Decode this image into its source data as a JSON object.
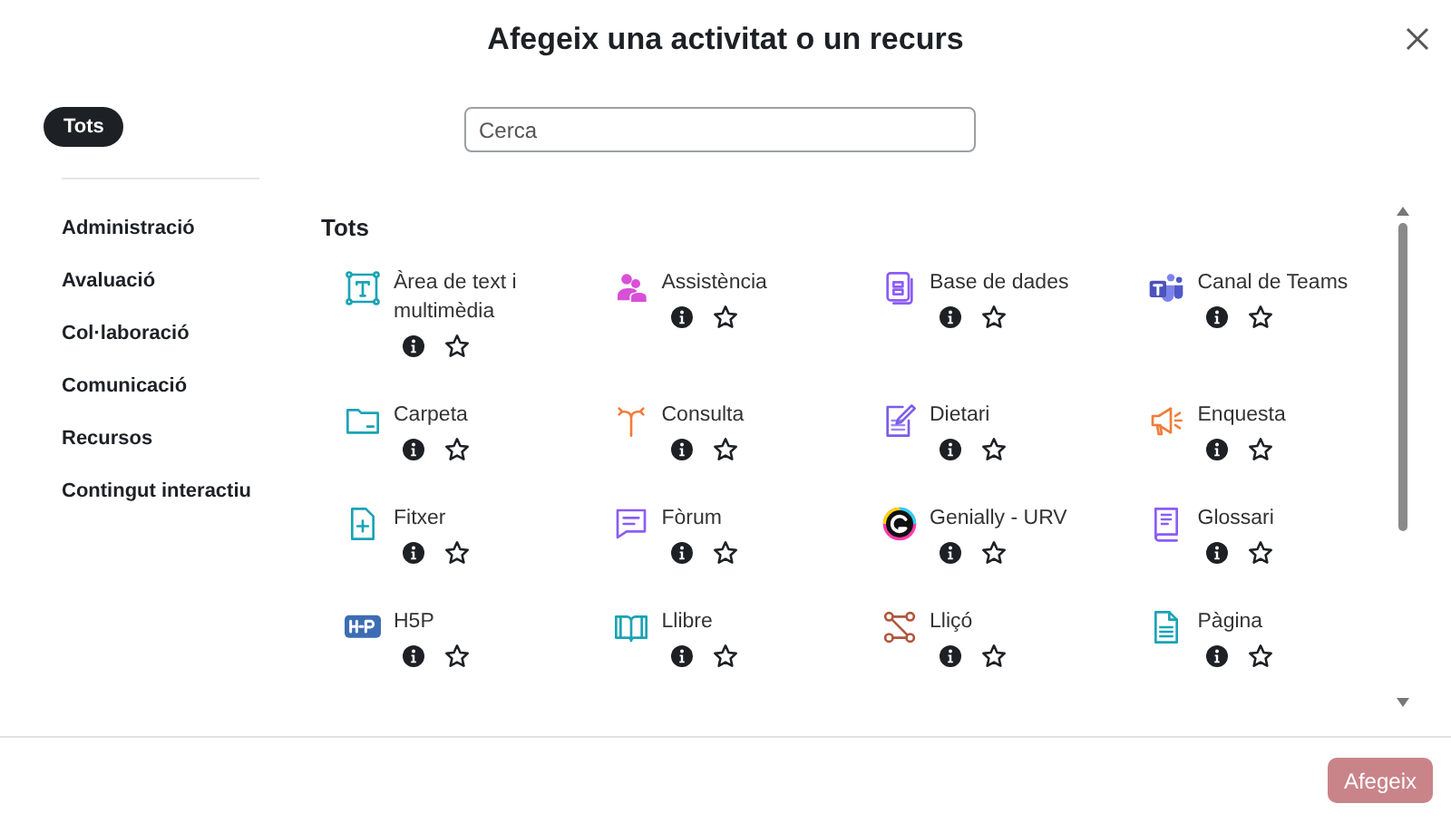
{
  "dialog": {
    "title": "Afegeix una activitat o un recurs"
  },
  "categories": [
    {
      "label": "Tots",
      "selected": true
    },
    {
      "label": "Administració",
      "selected": false
    },
    {
      "label": "Avaluació",
      "selected": false
    },
    {
      "label": "Col·laboració",
      "selected": false
    },
    {
      "label": "Comunicació",
      "selected": false
    },
    {
      "label": "Recursos",
      "selected": false
    },
    {
      "label": "Contingut interactiu",
      "selected": false
    }
  ],
  "search": {
    "placeholder": "Cerca"
  },
  "section_title": "Tots",
  "items": [
    {
      "label": "Àrea de text i multimèdia",
      "kind": "textarea",
      "starred": false
    },
    {
      "label": "Assistència",
      "kind": "attendance",
      "starred": false
    },
    {
      "label": "Base de dades",
      "kind": "database",
      "starred": false
    },
    {
      "label": "Canal de Teams",
      "kind": "teams",
      "starred": false
    },
    {
      "label": "Carpeta",
      "kind": "folder",
      "starred": false
    },
    {
      "label": "Consulta",
      "kind": "choice",
      "starred": false
    },
    {
      "label": "Dietari",
      "kind": "journal",
      "starred": false
    },
    {
      "label": "Enquesta",
      "kind": "survey",
      "starred": false
    },
    {
      "label": "Fitxer",
      "kind": "file",
      "starred": false
    },
    {
      "label": "Fòrum",
      "kind": "forum",
      "starred": false
    },
    {
      "label": "Genially - URV",
      "kind": "genially",
      "starred": false
    },
    {
      "label": "Glossari",
      "kind": "glossary",
      "starred": false
    },
    {
      "label": "H5P",
      "kind": "h5p",
      "starred": false
    },
    {
      "label": "Llibre",
      "kind": "book",
      "starred": false
    },
    {
      "label": "Lliçó",
      "kind": "lesson",
      "starred": false
    },
    {
      "label": "Pàgina",
      "kind": "page",
      "starred": false
    }
  ],
  "add_button": {
    "label": "Afegeix",
    "disabled": true
  }
}
